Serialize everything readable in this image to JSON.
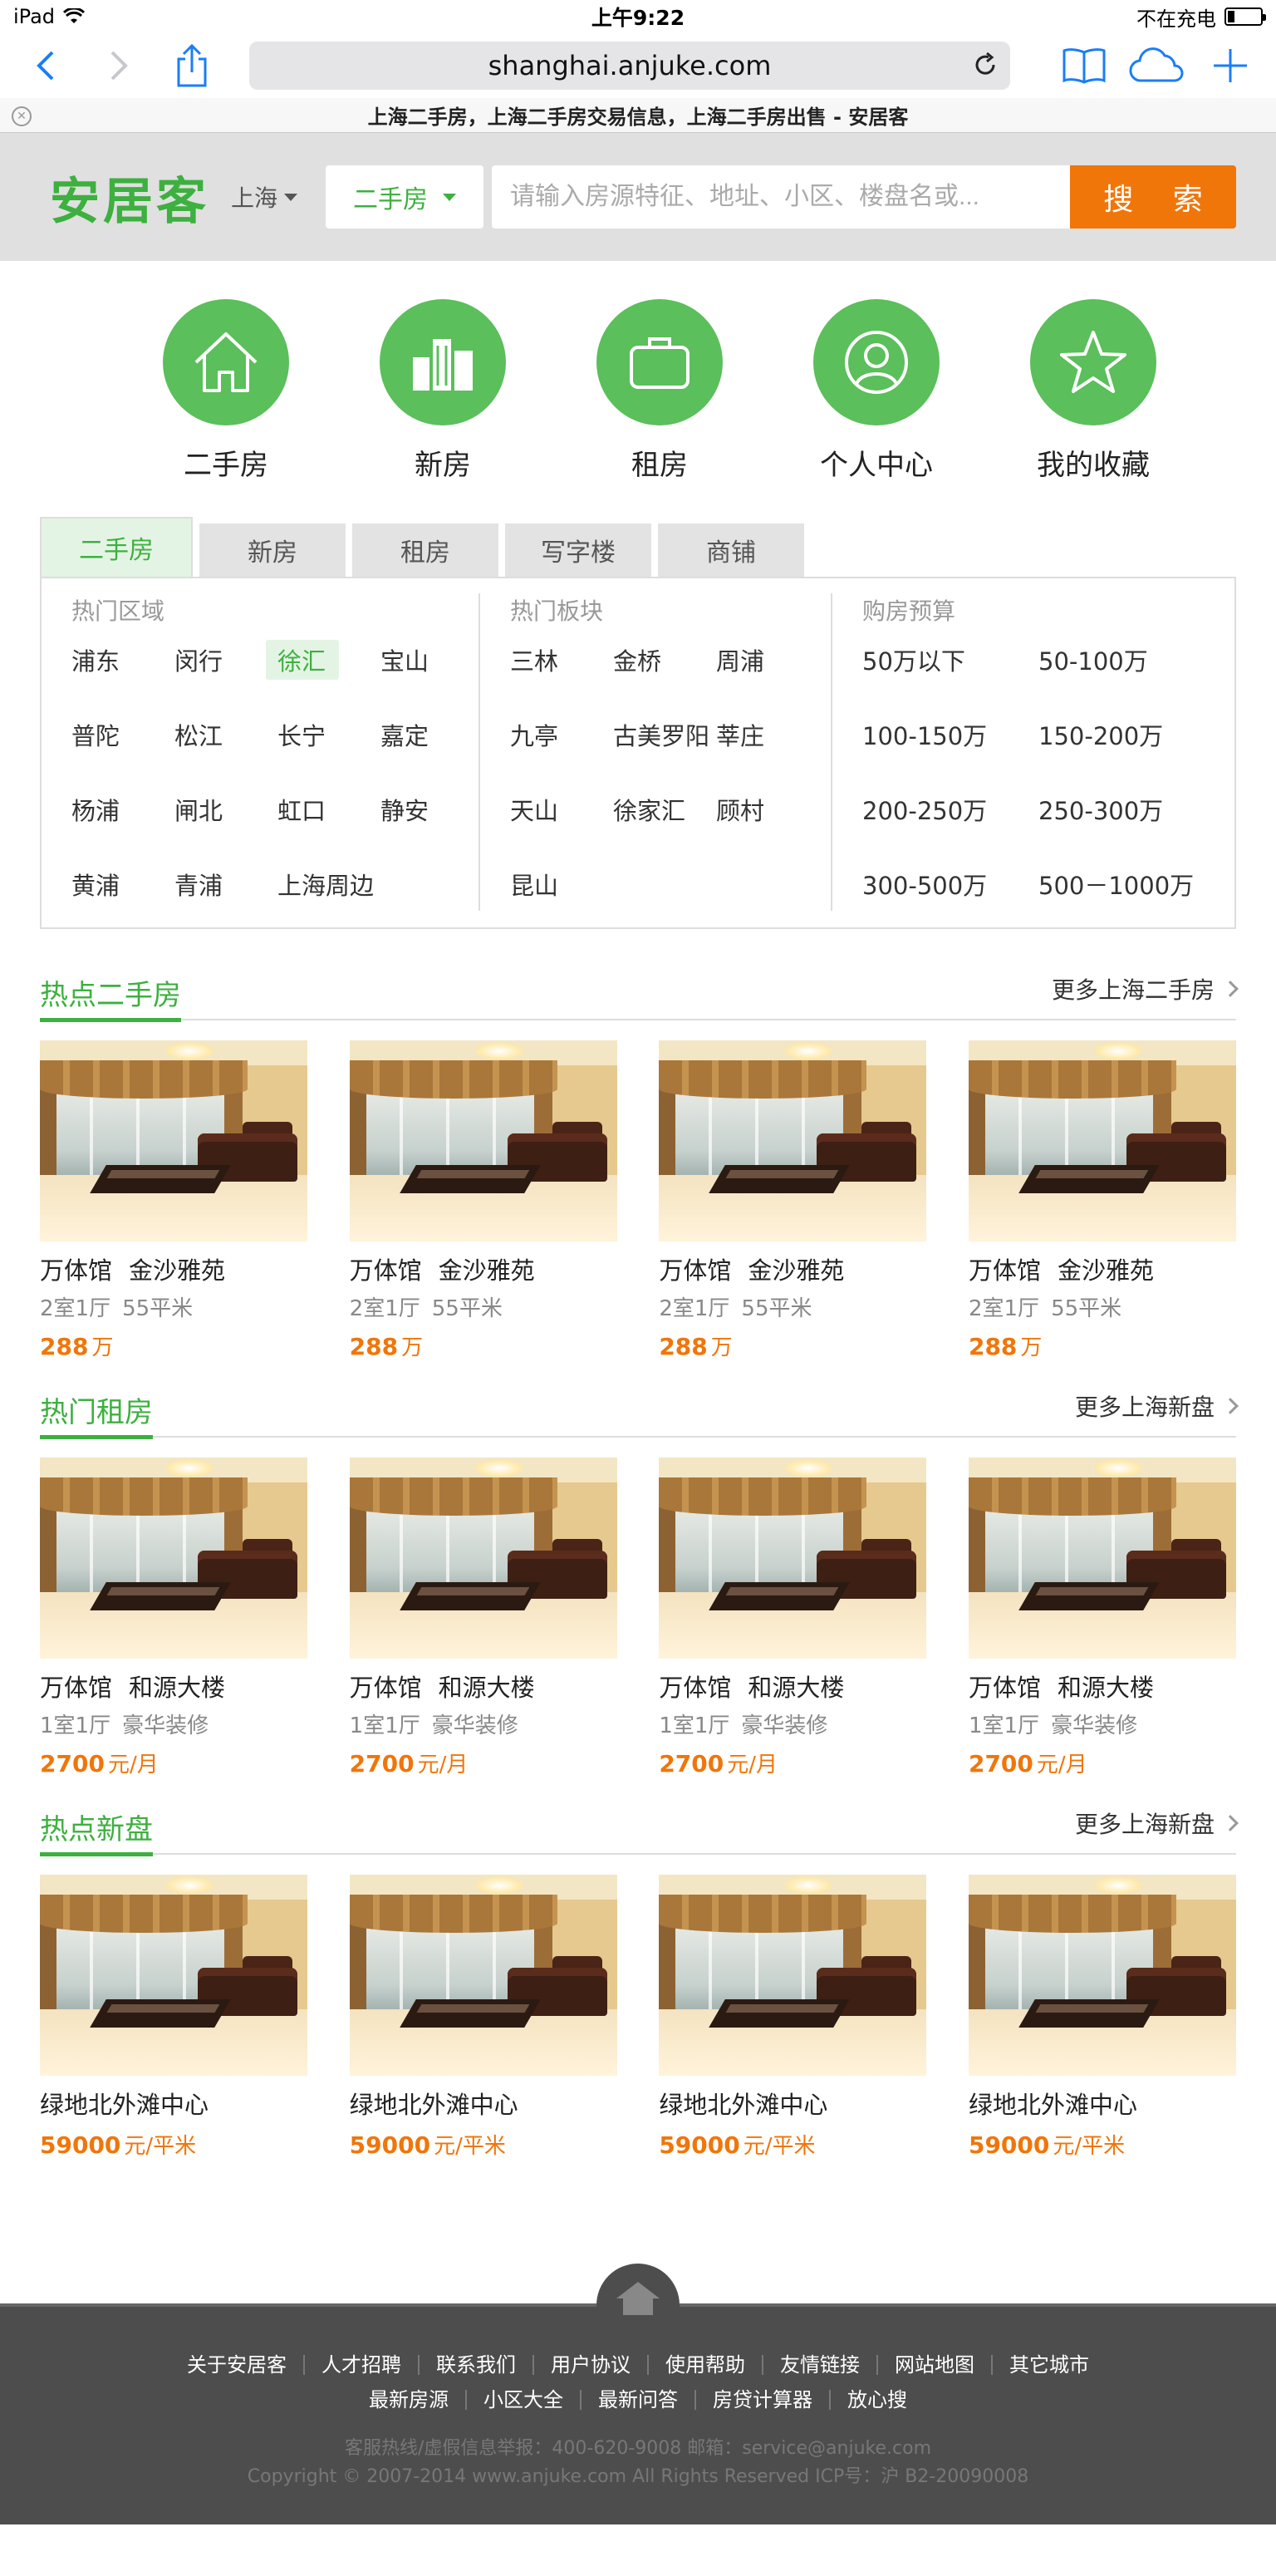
{
  "status": {
    "device": "iPad",
    "time": "上午9:22",
    "charge": "不在充电"
  },
  "browser": {
    "url": "shanghai.anjuke.com",
    "tab_title": "上海二手房，上海二手房交易信息，上海二手房出售 - 安居客"
  },
  "header": {
    "logo": "安居客",
    "city": "上海",
    "category": "二手房",
    "search_placeholder": "请输入房源特征、地址、小区、楼盘名或...",
    "search_button": "搜 索"
  },
  "nav": [
    {
      "label": "二手房",
      "icon": "home-icon"
    },
    {
      "label": "新房",
      "icon": "building-icon"
    },
    {
      "label": "租房",
      "icon": "briefcase-icon"
    },
    {
      "label": "个人中心",
      "icon": "user-icon"
    },
    {
      "label": "我的收藏",
      "icon": "star-icon"
    }
  ],
  "tabs": [
    "二手房",
    "新房",
    "租房",
    "写字楼",
    "商铺"
  ],
  "filters": {
    "regions": {
      "title": "热门区域",
      "items": [
        "浦东",
        "闵行",
        "徐汇",
        "宝山",
        "普陀",
        "松江",
        "长宁",
        "嘉定",
        "杨浦",
        "闸北",
        "虹口",
        "静安",
        "黄浦",
        "青浦",
        "上海周边"
      ]
    },
    "blocks": {
      "title": "热门板块",
      "items": [
        "三林",
        "金桥",
        "周浦",
        "九亭",
        "古美罗阳",
        "莘庄",
        "天山",
        "徐家汇",
        "顾村",
        "昆山"
      ]
    },
    "budget": {
      "title": "购房预算",
      "items": [
        "50万以下",
        "50-100万",
        "100-150万",
        "150-200万",
        "200-250万",
        "250-300万",
        "300-500万",
        "500－1000万"
      ]
    }
  },
  "sections": [
    {
      "title": "热点二手房",
      "more": "更多上海二手房",
      "cards": [
        {
          "district": "万体馆",
          "name": "金沙雅苑",
          "rooms": "2室1厅",
          "extra": "55平米",
          "price": "288",
          "unit": "万"
        },
        {
          "district": "万体馆",
          "name": "金沙雅苑",
          "rooms": "2室1厅",
          "extra": "55平米",
          "price": "288",
          "unit": "万"
        },
        {
          "district": "万体馆",
          "name": "金沙雅苑",
          "rooms": "2室1厅",
          "extra": "55平米",
          "price": "288",
          "unit": "万"
        },
        {
          "district": "万体馆",
          "name": "金沙雅苑",
          "rooms": "2室1厅",
          "extra": "55平米",
          "price": "288",
          "unit": "万"
        }
      ]
    },
    {
      "title": "热门租房",
      "more": "更多上海新盘",
      "cards": [
        {
          "district": "万体馆",
          "name": "和源大楼",
          "rooms": "1室1厅",
          "extra": "豪华装修",
          "price": "2700",
          "unit": "元/月"
        },
        {
          "district": "万体馆",
          "name": "和源大楼",
          "rooms": "1室1厅",
          "extra": "豪华装修",
          "price": "2700",
          "unit": "元/月"
        },
        {
          "district": "万体馆",
          "name": "和源大楼",
          "rooms": "1室1厅",
          "extra": "豪华装修",
          "price": "2700",
          "unit": "元/月"
        },
        {
          "district": "万体馆",
          "name": "和源大楼",
          "rooms": "1室1厅",
          "extra": "豪华装修",
          "price": "2700",
          "unit": "元/月"
        }
      ]
    },
    {
      "title": "热点新盘",
      "more": "更多上海新盘",
      "cards": [
        {
          "district": "",
          "name": "绿地北外滩中心",
          "rooms": "",
          "extra": "",
          "price": "59000",
          "unit": "元/平米"
        },
        {
          "district": "",
          "name": "绿地北外滩中心",
          "rooms": "",
          "extra": "",
          "price": "59000",
          "unit": "元/平米"
        },
        {
          "district": "",
          "name": "绿地北外滩中心",
          "rooms": "",
          "extra": "",
          "price": "59000",
          "unit": "元/平米"
        },
        {
          "district": "",
          "name": "绿地北外滩中心",
          "rooms": "",
          "extra": "",
          "price": "59000",
          "unit": "元/平米"
        }
      ]
    }
  ],
  "footer": {
    "links1": [
      "关于安居客",
      "人才招聘",
      "联系我们",
      "用户协议",
      "使用帮助",
      "友情链接",
      "网站地图",
      "其它城市"
    ],
    "links2": [
      "最新房源",
      "小区大全",
      "最新问答",
      "房贷计算器",
      "放心搜"
    ],
    "contact": "客服热线/虚假信息举报：400-620-9008    邮箱：service@anjuke.com",
    "copyright": "Copyright © 2007-2014 www.anjuke.com All Rights Reserved ICP号：沪 B2-20090008"
  },
  "colors": {
    "brand": "#3db03f",
    "accent": "#f0760a",
    "ios_blue": "#1a7ef5"
  }
}
